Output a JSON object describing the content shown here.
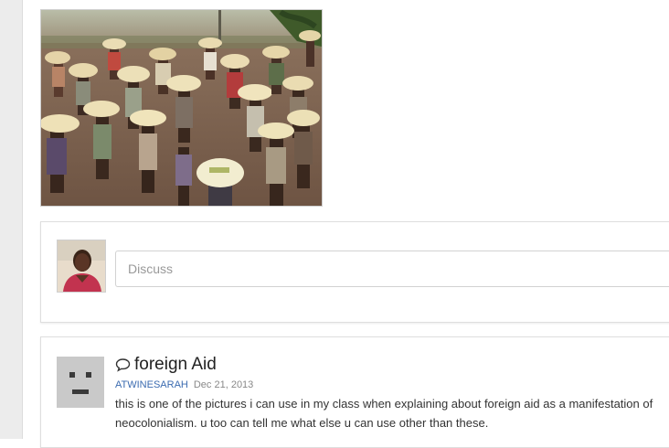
{
  "discuss": {
    "placeholder": "Discuss"
  },
  "post": {
    "title": "foreign Aid",
    "author": "ATWINESARAH",
    "date": "Dec 21, 2013",
    "body": "this is one of the pictures i can use in my class when explaining about foreign aid as a manifestation of neocolonialism. u too can tell me what else u can use other than these."
  },
  "icons": {
    "post_type": "speech-bubble-icon"
  },
  "colors": {
    "author_link": "#3b6bb0",
    "default_avatar": "#c9c9c9"
  }
}
